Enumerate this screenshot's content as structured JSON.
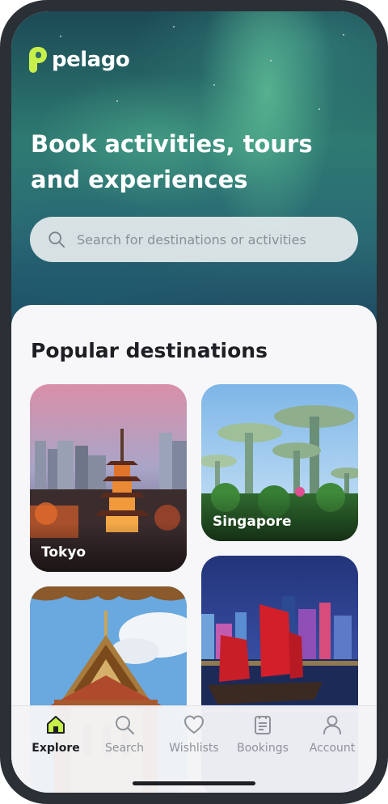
{
  "brand": {
    "name": "pelago"
  },
  "hero": {
    "headline": "Book activities, tours and experiences",
    "search_placeholder": "Search for destinations or activities"
  },
  "popular": {
    "title": "Popular destinations",
    "cards": [
      {
        "label": "Tokyo"
      },
      {
        "label": "Singapore"
      },
      {
        "label": ""
      },
      {
        "label": ""
      }
    ]
  },
  "tabbar": {
    "items": [
      {
        "label": "Explore",
        "icon": "home-icon",
        "active": true
      },
      {
        "label": "Search",
        "icon": "search-icon",
        "active": false
      },
      {
        "label": "Wishlists",
        "icon": "heart-icon",
        "active": false
      },
      {
        "label": "Bookings",
        "icon": "clipboard-icon",
        "active": false
      },
      {
        "label": "Account",
        "icon": "user-icon",
        "active": false
      }
    ]
  },
  "colors": {
    "accent": "#c8f04a",
    "text_dark": "#1d1f24",
    "tab_inactive": "#8e9299"
  }
}
